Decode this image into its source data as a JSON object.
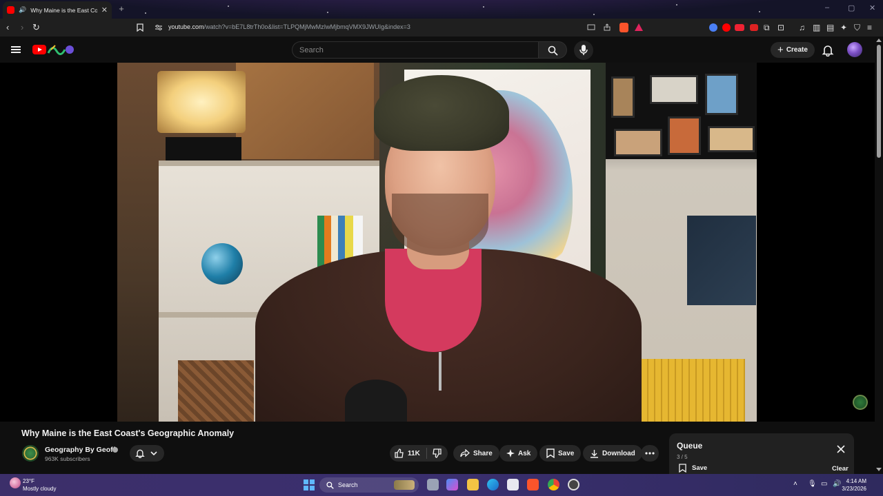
{
  "browser": {
    "tab_title": "Why Maine is the East Coast's...",
    "url_host": "youtube.com",
    "url_path": "/watch?v=bE7L8trTh0o&list=TLPQMjMwMzIwMjbmqVMX9JWUIg&index=3"
  },
  "youtube": {
    "search_placeholder": "Search",
    "create_label": "Create"
  },
  "video": {
    "title": "Why Maine is the East Coast's Geographic Anomaly",
    "channel_name": "Geography By Geoff",
    "subscribers": "963K subscribers",
    "like_count": "11K",
    "share_label": "Share",
    "ask_label": "Ask",
    "save_label": "Save",
    "download_label": "Download"
  },
  "queue": {
    "title": "Queue",
    "count": "3 / 5",
    "save_label": "Save",
    "clear_label": "Clear"
  },
  "taskbar": {
    "temperature": "23°F",
    "weather": "Mostly cloudy",
    "search_label": "Search",
    "time": "4:14 AM",
    "date": "3/23/2026"
  },
  "colors": {
    "youtube_red": "#ff0000",
    "background": "#0f0f0f",
    "pill_bg": "#272727"
  }
}
